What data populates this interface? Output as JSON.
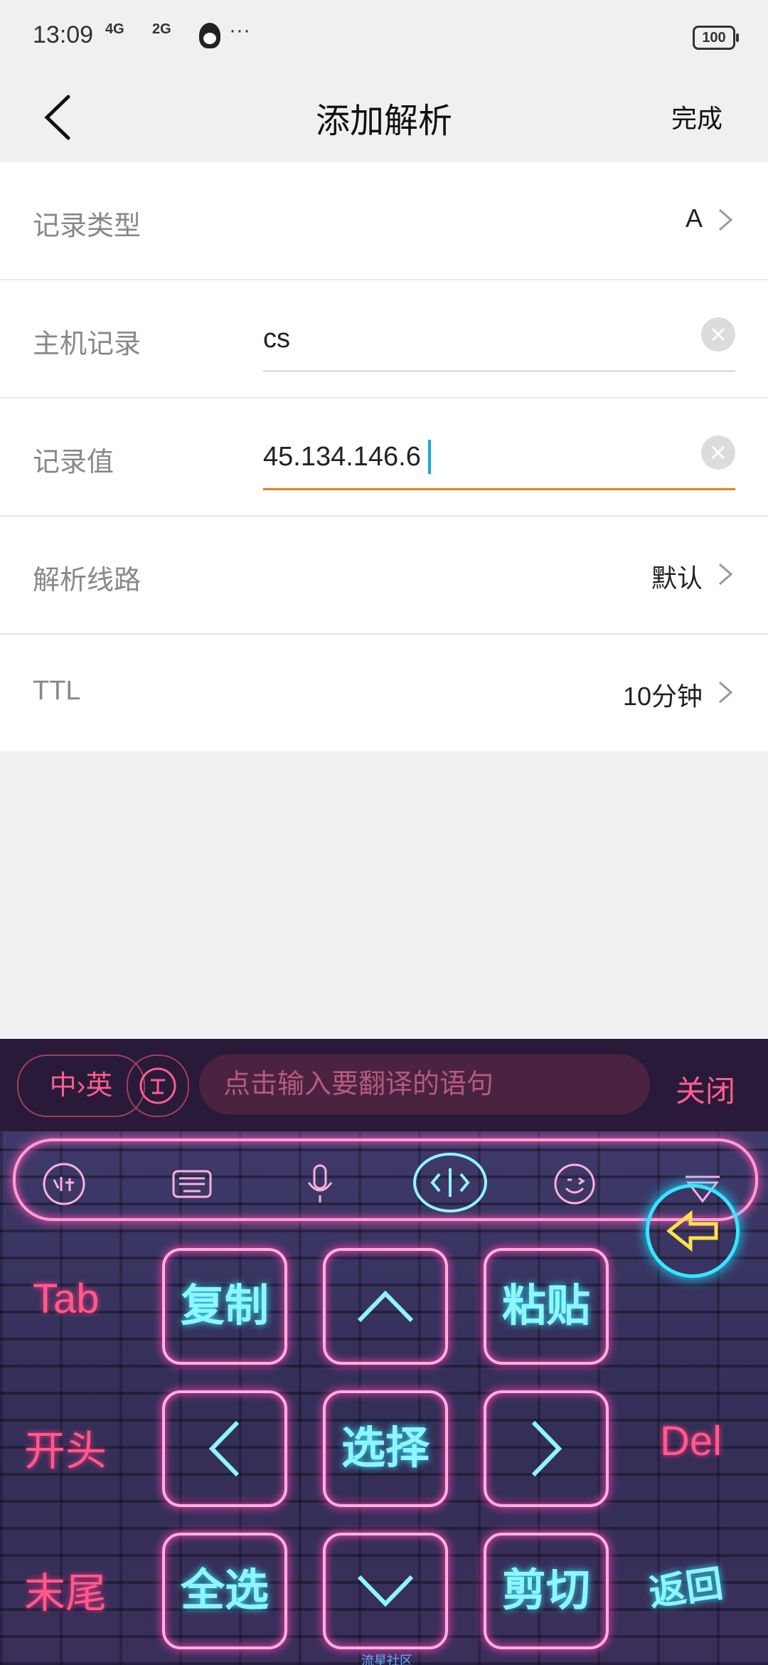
{
  "status": {
    "time": "13:09",
    "net1": "4G",
    "net2": "2G",
    "more": "···",
    "battery": "100"
  },
  "header": {
    "title": "添加解析",
    "done": "完成"
  },
  "form": {
    "record_type": {
      "label": "记录类型",
      "value": "A"
    },
    "host": {
      "label": "主机记录",
      "value": "cs"
    },
    "record_value": {
      "label": "记录值",
      "value": "45.134.146.6"
    },
    "line": {
      "label": "解析线路",
      "value": "默认"
    },
    "ttl": {
      "label": "TTL",
      "value": "10分钟"
    }
  },
  "translate": {
    "lang_toggle": "中›英",
    "placeholder": "点击输入要翻译的语句",
    "close": "关闭"
  },
  "keyboard": {
    "tab": "Tab",
    "start": "开头",
    "end": "末尾",
    "del": "Del",
    "copy": "复制",
    "paste": "粘贴",
    "select": "选择",
    "select_all": "全选",
    "cut": "剪切",
    "back": "返回",
    "footer": "流星社区"
  },
  "colors": {
    "accent": "#f37b16",
    "cursor": "#1aa7d8",
    "neon_pink": "#ff5a8c",
    "neon_cyan": "#8ff6ff"
  }
}
